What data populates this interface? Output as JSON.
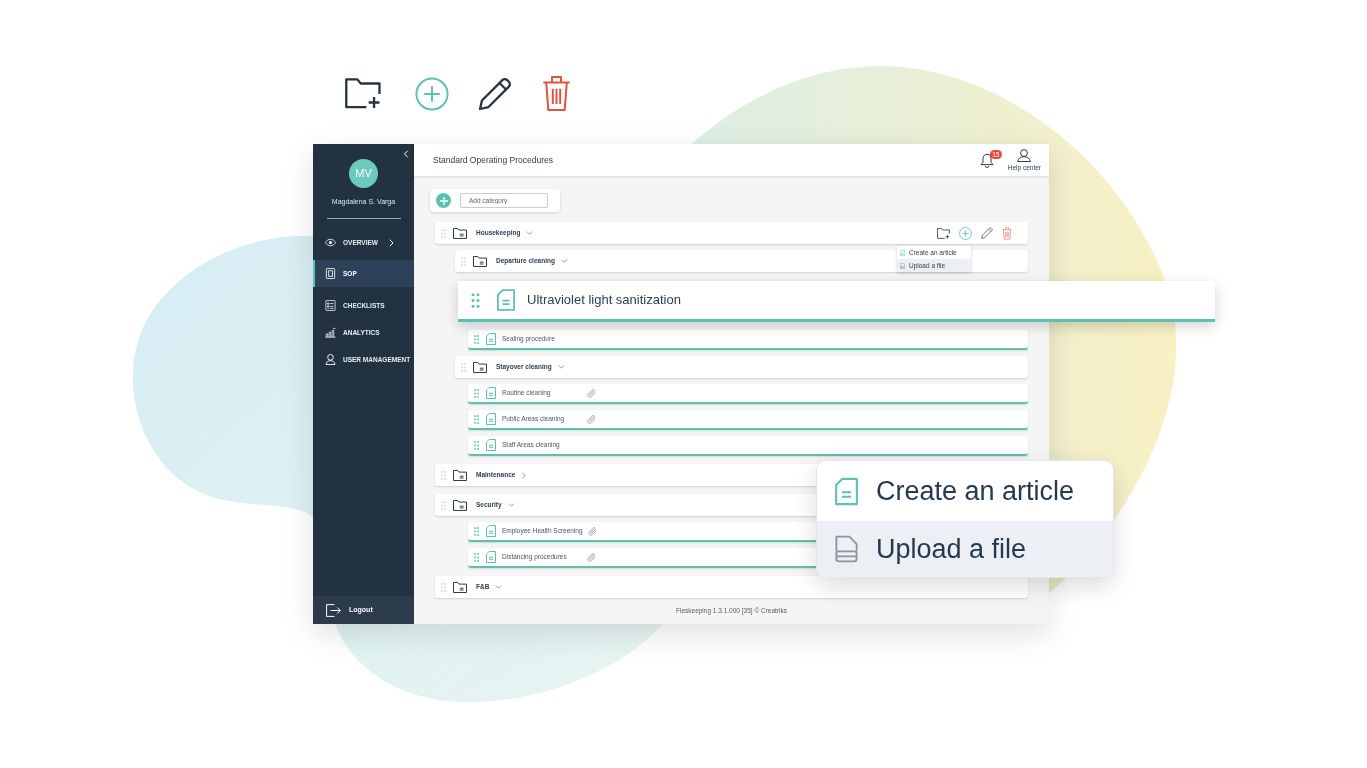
{
  "sidebar": {
    "avatar": "MV",
    "user_name": "Magdalena S. Varga",
    "items": [
      {
        "label": "OVERVIEW",
        "kind": "group",
        "selected": false
      },
      {
        "label": "SOP",
        "kind": "link",
        "selected": true
      },
      {
        "label": "CHECKLISTS",
        "kind": "link",
        "selected": false
      },
      {
        "label": "ANALYTICS",
        "kind": "link",
        "selected": false
      },
      {
        "label": "USER MANAGEMENT",
        "kind": "link",
        "selected": false
      }
    ],
    "logout": "Logout"
  },
  "header": {
    "title": "Standard Operating Procedures",
    "notification_count": "15",
    "help": "Help center"
  },
  "add_category": {
    "placeholder": "Add category"
  },
  "tree": [
    {
      "kind": "category",
      "label": "Housekeeping",
      "expanded": true,
      "hovered": true,
      "menu": [
        {
          "label": "Create an article",
          "selected": false
        },
        {
          "label": "Upload a file",
          "selected": true
        }
      ],
      "children": [
        {
          "kind": "category",
          "label": "Departure cleaning",
          "expanded": true,
          "hovered": false,
          "children": [
            {
              "kind": "article",
              "label": "Ultraviolet light sanitization",
              "attachment": false,
              "dragging": true
            },
            {
              "kind": "article",
              "label": "Sealing procedure",
              "attachment": false,
              "dragging": false
            }
          ]
        },
        {
          "kind": "category",
          "label": "Stayover cleaning",
          "expanded": true,
          "hovered": false,
          "children": [
            {
              "kind": "article",
              "label": "Routine cleaning",
              "attachment": true,
              "dragging": false
            },
            {
              "kind": "article",
              "label": "Public Areas cleaning",
              "attachment": true,
              "dragging": false
            },
            {
              "kind": "article",
              "label": "Staff Areas cleaning",
              "attachment": false,
              "dragging": false
            }
          ]
        }
      ]
    },
    {
      "kind": "category",
      "label": "Maintenance",
      "expanded": false,
      "hovered": false
    },
    {
      "kind": "category",
      "label": "Security",
      "expanded": true,
      "hovered": false,
      "children": [
        {
          "kind": "article",
          "label": "Employee Health Screening",
          "attachment": true,
          "dragging": false
        },
        {
          "kind": "article",
          "label": "Distancing procedures",
          "attachment": true,
          "dragging": false
        }
      ]
    },
    {
      "kind": "category",
      "label": "F&B",
      "expanded": true,
      "hovered": false
    }
  ],
  "footer": "Fleskeeping 1.3.1.000 [35] © Creatriks",
  "callout_menu": [
    {
      "label": "Create an article",
      "selected": false
    },
    {
      "label": "Upload a file",
      "selected": true
    }
  ]
}
